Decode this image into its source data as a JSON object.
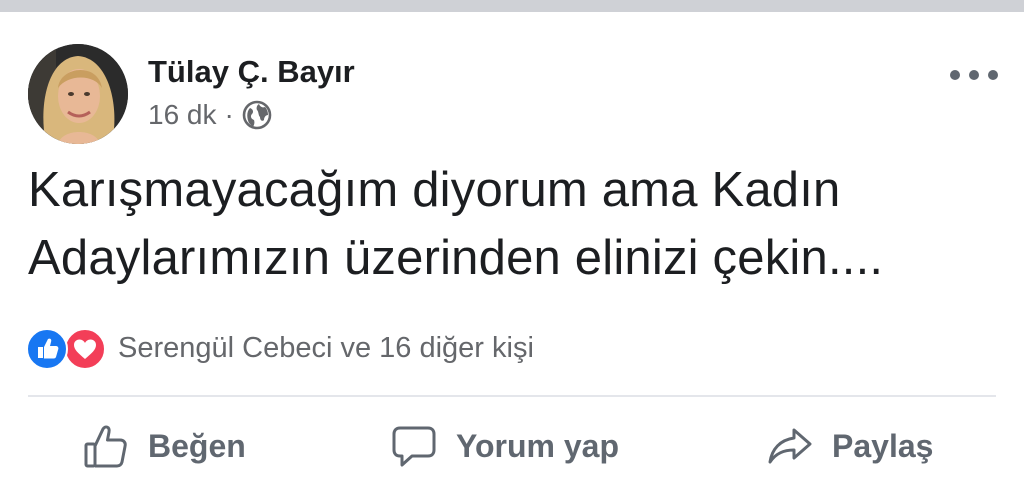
{
  "post": {
    "author": "Tülay Ç. Bayır",
    "time": "16 dk",
    "separator": "·",
    "audience_icon": "globe-icon",
    "text_lines": [
      "Karışmayacağım diyorum ama Kadın",
      "Adaylarımızın üzerinden elinizi çekin...."
    ]
  },
  "reactions": {
    "icons": [
      "like-reaction-icon",
      "love-reaction-icon"
    ],
    "summary": "Serengül Cebeci ve 16 diğer kişi"
  },
  "actions": {
    "like": "Beğen",
    "comment": "Yorum yap",
    "share": "Paylaş"
  },
  "colors": {
    "like_blue": "#1877f2",
    "love_red": "#f33e58",
    "secondary_text": "#65676b"
  }
}
